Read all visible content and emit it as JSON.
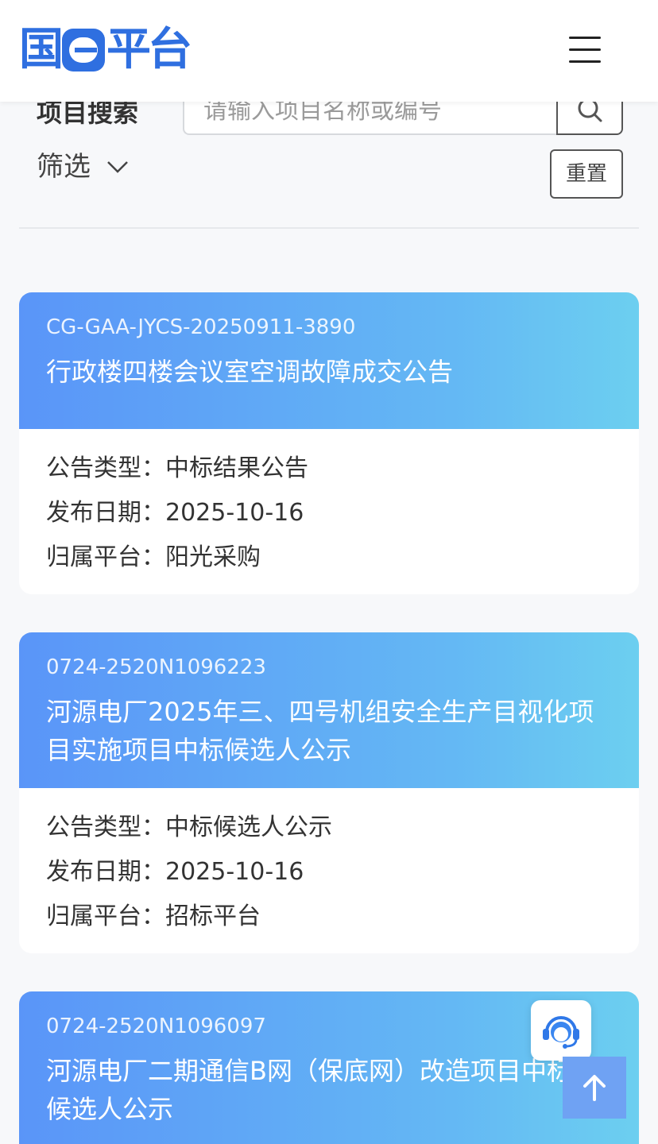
{
  "header": {
    "logo_prefix": "国",
    "logo_suffix": "平台",
    "menu_icon": "hamburger-menu-icon"
  },
  "search": {
    "label": "项目搜索",
    "placeholder": "请输入项目名称或编号",
    "button_icon": "search-icon"
  },
  "filter": {
    "label": "筛选",
    "icon": "chevron-down-icon"
  },
  "reset": {
    "label": "重置"
  },
  "colors": {
    "brand": "#2f6fe0",
    "card_gradient_start": "#5a95f8",
    "card_gradient_end": "#6ccff0",
    "top_button": "#6fa2f3"
  },
  "labels": {
    "type": "公告类型：",
    "date": "发布日期：",
    "platform": "归属平台："
  },
  "cards": [
    {
      "code": "CG-GAA-JYCS-20250911-3890",
      "title": "行政楼四楼会议室空调故障成交公告",
      "type": "中标结果公告",
      "date": "2025-10-16",
      "platform": "阳光采购"
    },
    {
      "code": "0724-2520N1096223",
      "title": "河源电厂2025年三、四号机组安全生产目视化项目实施项目中标候选人公示",
      "type": "中标候选人公示",
      "date": "2025-10-16",
      "platform": "招标平台"
    },
    {
      "code": "0724-2520N1096097",
      "title": "河源电厂二期通信B网（保底网）改造项目中标候选人公示"
    }
  ],
  "floating": {
    "customer_service_icon": "customer-service-icon",
    "back_to_top_icon": "arrow-up-icon"
  }
}
